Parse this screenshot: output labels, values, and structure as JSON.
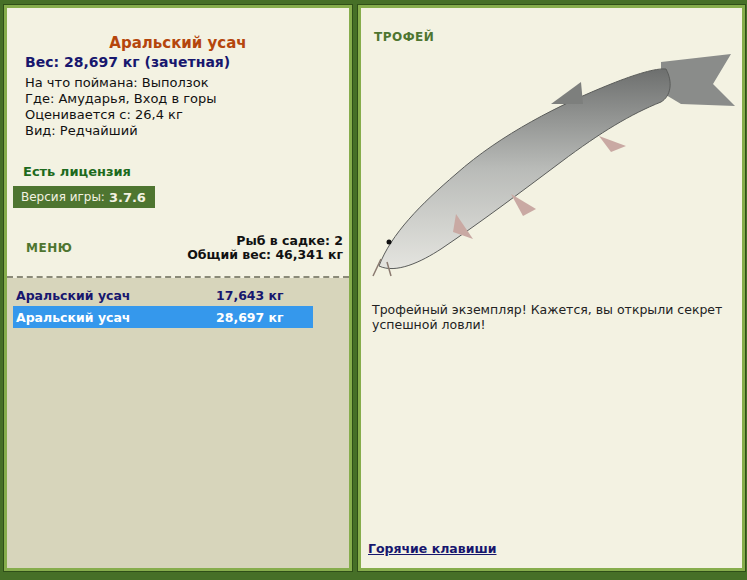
{
  "fish": {
    "name": "Аральский усач",
    "weight": "Вес: 28,697 кг (зачетная)",
    "details": [
      "На что поймана: Выползок",
      "Где: Амудaрья, Вход в горы",
      "Оценивается с: 26,4 кг",
      "Вид: Редчайший"
    ]
  },
  "license": "Есть лицензия",
  "version": {
    "label": "Версия игры:",
    "value": "3.7.6"
  },
  "menu": "МЕНЮ",
  "cage": {
    "count": "Рыб в садке: 2",
    "total": "Общий вес: 46,341 кг"
  },
  "catch_list": [
    {
      "name": "Аральский усач",
      "weight": "17,643 кг",
      "selected": false
    },
    {
      "name": "Аральский усач",
      "weight": "28,697 кг",
      "selected": true
    }
  ],
  "trophy": {
    "title": "ТРОФЕЙ",
    "message": "Трофейный экземпляр! Кажется, вы открыли секрет успешной ловли!"
  },
  "hotkeys": "Горячие клавиши"
}
